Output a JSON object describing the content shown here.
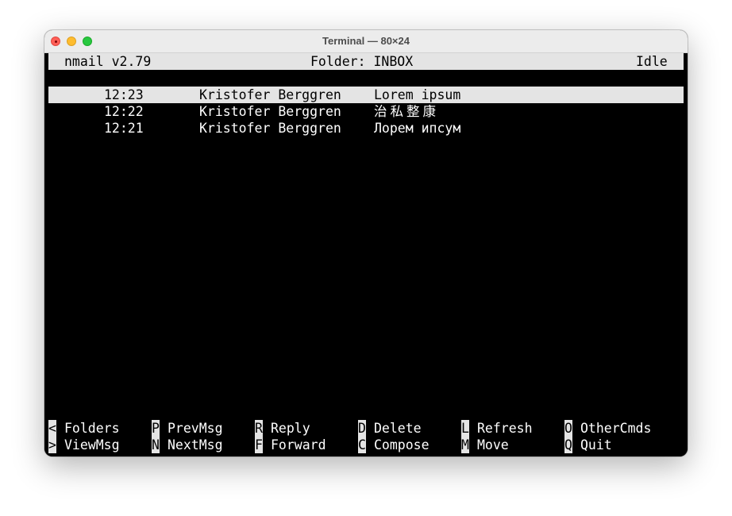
{
  "window": {
    "title": "Terminal — 80×24"
  },
  "header": {
    "app_version": "nmail v2.79",
    "folder": "Folder: INBOX",
    "status": "Idle"
  },
  "messages": [
    {
      "time": "12:23",
      "from": "Kristofer Berggren",
      "subject": "Lorem ipsum",
      "selected": true
    },
    {
      "time": "12:22",
      "from": "Kristofer Berggren",
      "subject": "治私整康",
      "selected": false
    },
    {
      "time": "12:21",
      "from": "Kristofer Berggren",
      "subject": "Лорем ипсум",
      "selected": false
    }
  ],
  "help": {
    "row1": [
      {
        "key": "<",
        "label": "Folders"
      },
      {
        "key": "P",
        "label": "PrevMsg"
      },
      {
        "key": "R",
        "label": "Reply"
      },
      {
        "key": "D",
        "label": "Delete"
      },
      {
        "key": "L",
        "label": "Refresh"
      },
      {
        "key": "O",
        "label": "OtherCmds"
      }
    ],
    "row2": [
      {
        "key": ">",
        "label": "ViewMsg"
      },
      {
        "key": "N",
        "label": "NextMsg"
      },
      {
        "key": "F",
        "label": "Forward"
      },
      {
        "key": "C",
        "label": "Compose"
      },
      {
        "key": "M",
        "label": "Move"
      },
      {
        "key": "Q",
        "label": "Quit"
      }
    ]
  },
  "colors": {
    "terminal_background": "#000000",
    "terminal_foreground": "#ffffff",
    "inverse_background": "#e4e4e4",
    "traffic_red": "#fe5f57",
    "traffic_yellow": "#febc2e",
    "traffic_green": "#28c840"
  }
}
